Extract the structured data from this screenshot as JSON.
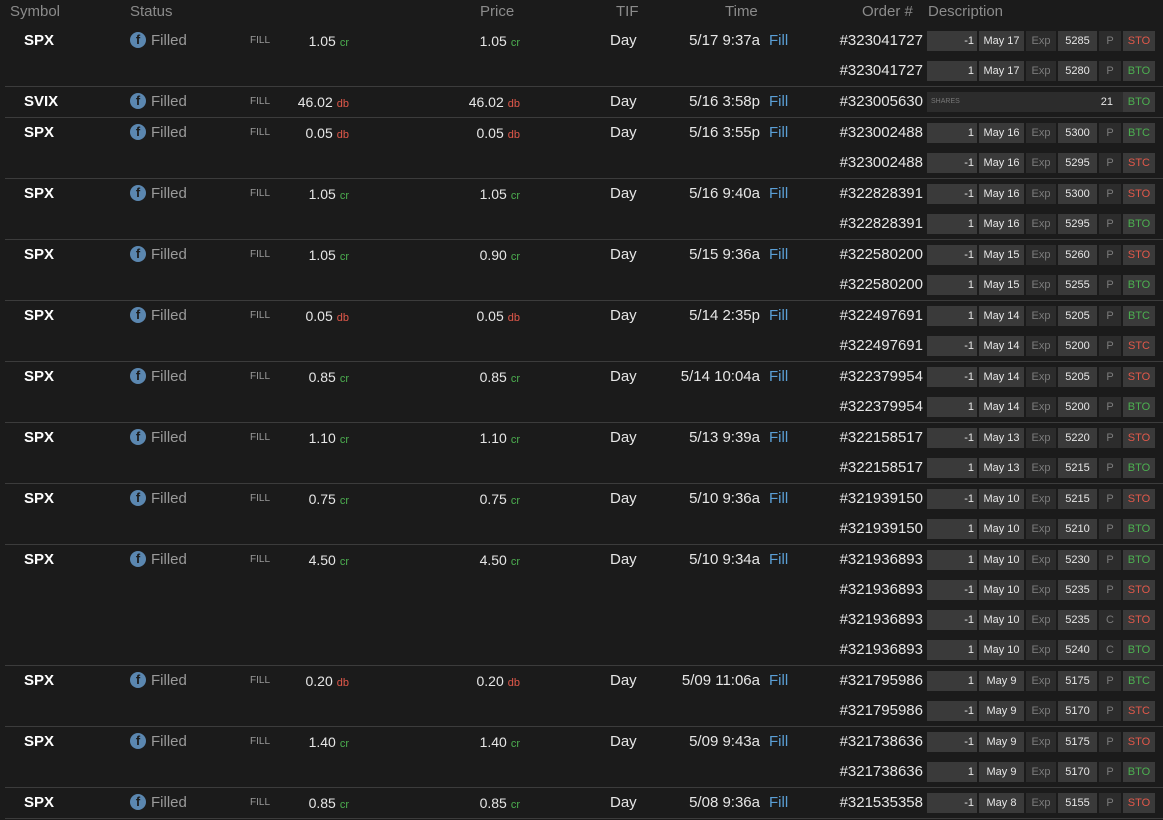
{
  "header": {
    "symbol": "Symbol",
    "status": "Status",
    "price": "Price",
    "tif": "TIF",
    "time": "Time",
    "order": "Order #",
    "description": "Description"
  },
  "status_label": "Filled",
  "fill_tag": "FILL",
  "fill_link": "Fill",
  "tif_value": "Day",
  "exp_label": "Exp",
  "shares_label": "SHARES",
  "colors": {
    "credit": "#4caf50",
    "debit": "#e0584a",
    "link": "#5b9fd6",
    "icon": "#5b87b0"
  },
  "orders": [
    {
      "symbol": "SPX",
      "price1": "1.05",
      "unit1": "cr",
      "price2": "1.05",
      "unit2": "cr",
      "time": "5/17 9:37a",
      "legs": [
        {
          "order": "#323041727",
          "qty": "-1",
          "exp": "May 17",
          "strike": "5285",
          "type": "P",
          "action": "STO"
        },
        {
          "order": "#323041727",
          "qty": "1",
          "exp": "May 17",
          "strike": "5280",
          "type": "P",
          "action": "BTO"
        }
      ]
    },
    {
      "symbol": "SVIX",
      "price1": "46.02",
      "unit1": "db",
      "price2": "46.02",
      "unit2": "db",
      "time": "5/16 3:58p",
      "legs": [
        {
          "order": "#323005630",
          "shares": true,
          "qty": "21",
          "action": "BTO"
        }
      ]
    },
    {
      "symbol": "SPX",
      "price1": "0.05",
      "unit1": "db",
      "price2": "0.05",
      "unit2": "db",
      "time": "5/16 3:55p",
      "legs": [
        {
          "order": "#323002488",
          "qty": "1",
          "exp": "May 16",
          "strike": "5300",
          "type": "P",
          "action": "BTC"
        },
        {
          "order": "#323002488",
          "qty": "-1",
          "exp": "May 16",
          "strike": "5295",
          "type": "P",
          "action": "STC"
        }
      ]
    },
    {
      "symbol": "SPX",
      "price1": "1.05",
      "unit1": "cr",
      "price2": "1.05",
      "unit2": "cr",
      "time": "5/16 9:40a",
      "legs": [
        {
          "order": "#322828391",
          "qty": "-1",
          "exp": "May 16",
          "strike": "5300",
          "type": "P",
          "action": "STO"
        },
        {
          "order": "#322828391",
          "qty": "1",
          "exp": "May 16",
          "strike": "5295",
          "type": "P",
          "action": "BTO"
        }
      ]
    },
    {
      "symbol": "SPX",
      "price1": "1.05",
      "unit1": "cr",
      "price2": "0.90",
      "unit2": "cr",
      "time": "5/15 9:36a",
      "legs": [
        {
          "order": "#322580200",
          "qty": "-1",
          "exp": "May 15",
          "strike": "5260",
          "type": "P",
          "action": "STO"
        },
        {
          "order": "#322580200",
          "qty": "1",
          "exp": "May 15",
          "strike": "5255",
          "type": "P",
          "action": "BTO"
        }
      ]
    },
    {
      "symbol": "SPX",
      "price1": "0.05",
      "unit1": "db",
      "price2": "0.05",
      "unit2": "db",
      "time": "5/14 2:35p",
      "legs": [
        {
          "order": "#322497691",
          "qty": "1",
          "exp": "May 14",
          "strike": "5205",
          "type": "P",
          "action": "BTC"
        },
        {
          "order": "#322497691",
          "qty": "-1",
          "exp": "May 14",
          "strike": "5200",
          "type": "P",
          "action": "STC"
        }
      ]
    },
    {
      "symbol": "SPX",
      "price1": "0.85",
      "unit1": "cr",
      "price2": "0.85",
      "unit2": "cr",
      "time": "5/14 10:04a",
      "legs": [
        {
          "order": "#322379954",
          "qty": "-1",
          "exp": "May 14",
          "strike": "5205",
          "type": "P",
          "action": "STO"
        },
        {
          "order": "#322379954",
          "qty": "1",
          "exp": "May 14",
          "strike": "5200",
          "type": "P",
          "action": "BTO"
        }
      ]
    },
    {
      "symbol": "SPX",
      "price1": "1.10",
      "unit1": "cr",
      "price2": "1.10",
      "unit2": "cr",
      "time": "5/13 9:39a",
      "legs": [
        {
          "order": "#322158517",
          "qty": "-1",
          "exp": "May 13",
          "strike": "5220",
          "type": "P",
          "action": "STO"
        },
        {
          "order": "#322158517",
          "qty": "1",
          "exp": "May 13",
          "strike": "5215",
          "type": "P",
          "action": "BTO"
        }
      ]
    },
    {
      "symbol": "SPX",
      "price1": "0.75",
      "unit1": "cr",
      "price2": "0.75",
      "unit2": "cr",
      "time": "5/10 9:36a",
      "legs": [
        {
          "order": "#321939150",
          "qty": "-1",
          "exp": "May 10",
          "strike": "5215",
          "type": "P",
          "action": "STO"
        },
        {
          "order": "#321939150",
          "qty": "1",
          "exp": "May 10",
          "strike": "5210",
          "type": "P",
          "action": "BTO"
        }
      ]
    },
    {
      "symbol": "SPX",
      "price1": "4.50",
      "unit1": "cr",
      "price2": "4.50",
      "unit2": "cr",
      "time": "5/10 9:34a",
      "legs": [
        {
          "order": "#321936893",
          "qty": "1",
          "exp": "May 10",
          "strike": "5230",
          "type": "P",
          "action": "BTO"
        },
        {
          "order": "#321936893",
          "qty": "-1",
          "exp": "May 10",
          "strike": "5235",
          "type": "P",
          "action": "STO"
        },
        {
          "order": "#321936893",
          "qty": "-1",
          "exp": "May 10",
          "strike": "5235",
          "type": "C",
          "action": "STO"
        },
        {
          "order": "#321936893",
          "qty": "1",
          "exp": "May 10",
          "strike": "5240",
          "type": "C",
          "action": "BTO"
        }
      ]
    },
    {
      "symbol": "SPX",
      "price1": "0.20",
      "unit1": "db",
      "price2": "0.20",
      "unit2": "db",
      "time": "5/09 11:06a",
      "legs": [
        {
          "order": "#321795986",
          "qty": "1",
          "exp": "May 9",
          "strike": "5175",
          "type": "P",
          "action": "BTC"
        },
        {
          "order": "#321795986",
          "qty": "-1",
          "exp": "May 9",
          "strike": "5170",
          "type": "P",
          "action": "STC"
        }
      ]
    },
    {
      "symbol": "SPX",
      "price1": "1.40",
      "unit1": "cr",
      "price2": "1.40",
      "unit2": "cr",
      "time": "5/09 9:43a",
      "legs": [
        {
          "order": "#321738636",
          "qty": "-1",
          "exp": "May 9",
          "strike": "5175",
          "type": "P",
          "action": "STO"
        },
        {
          "order": "#321738636",
          "qty": "1",
          "exp": "May 9",
          "strike": "5170",
          "type": "P",
          "action": "BTO"
        }
      ]
    },
    {
      "symbol": "SPX",
      "price1": "0.85",
      "unit1": "cr",
      "price2": "0.85",
      "unit2": "cr",
      "time": "5/08 9:36a",
      "legs": [
        {
          "order": "#321535358",
          "qty": "-1",
          "exp": "May 8",
          "strike": "5155",
          "type": "P",
          "action": "STO"
        }
      ]
    }
  ]
}
